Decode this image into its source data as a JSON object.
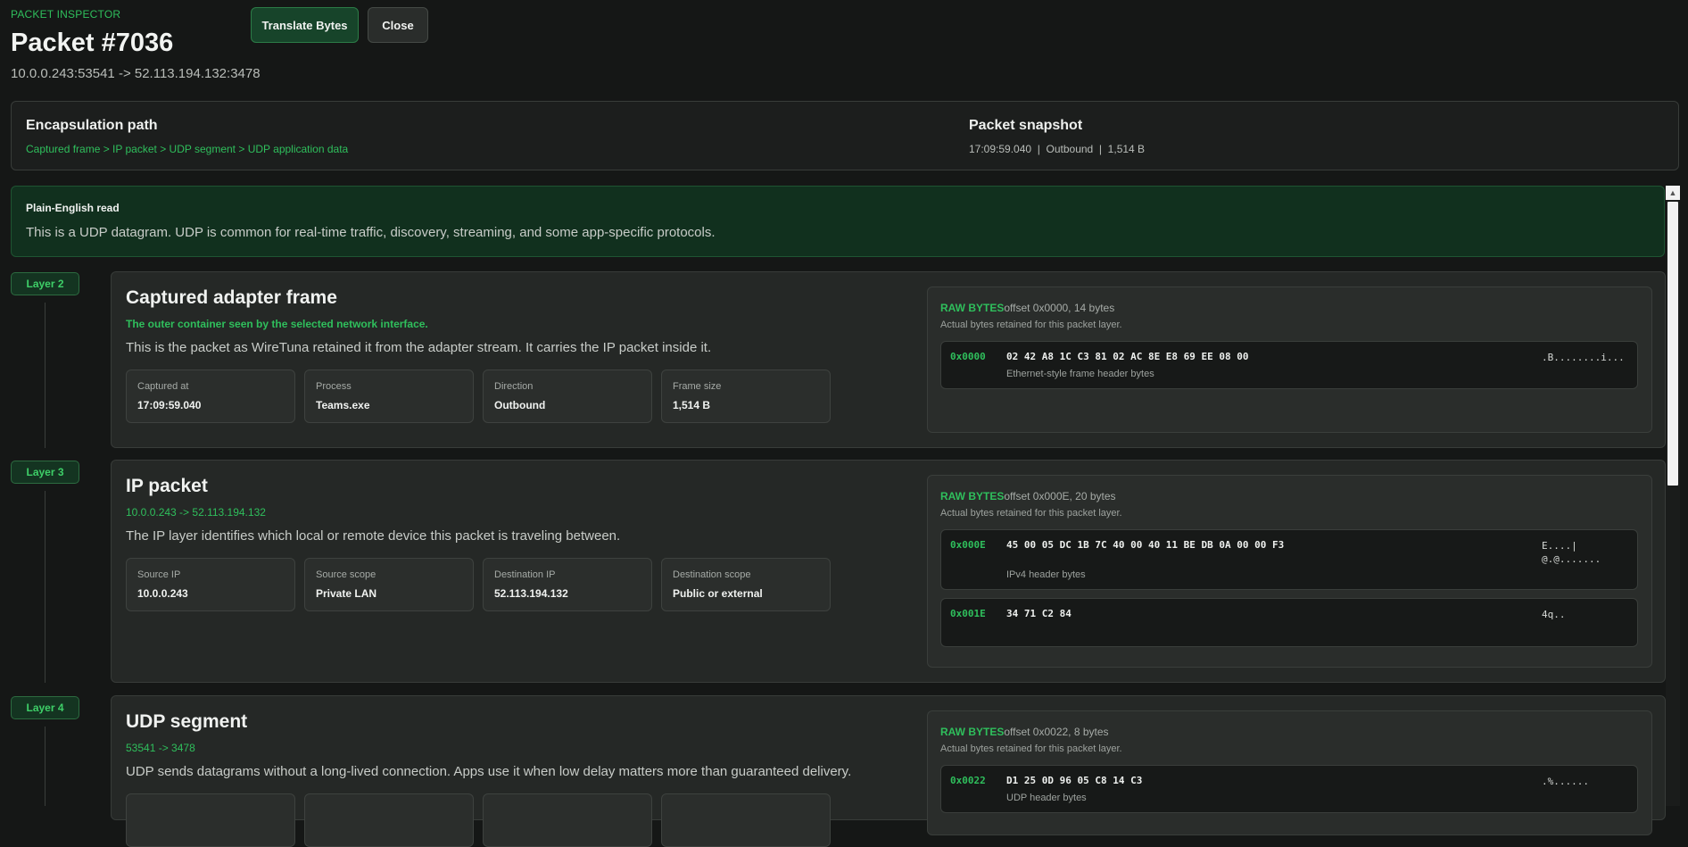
{
  "header": {
    "eyebrow": "PACKET INSPECTOR",
    "title": "Packet #7036",
    "subtitle": "10.0.0.243:53541 -> 52.113.194.132:3478",
    "translate_label": "Translate Bytes",
    "close_label": "Close"
  },
  "summary": {
    "encap_heading": "Encapsulation path",
    "encap_path": "Captured frame > IP packet > UDP segment > UDP application data",
    "snapshot_heading": "Packet snapshot",
    "snapshot_text": "17:09:59.040  |  Outbound  |  1,514 B"
  },
  "plain": {
    "heading": "Plain-English read",
    "text": "This is a UDP datagram. UDP is common for real-time traffic, discovery, streaming, and some app-specific protocols."
  },
  "layers": [
    {
      "pill": "Layer 2",
      "title": "Captured adapter frame",
      "subtitle": "The outer container seen by the selected network interface.",
      "description": "This is the packet as WireTuna retained it from the adapter stream. It carries the IP packet inside it.",
      "fields": [
        {
          "label": "Captured at",
          "value": "17:09:59.040"
        },
        {
          "label": "Process",
          "value": "Teams.exe"
        },
        {
          "label": "Direction",
          "value": "Outbound"
        },
        {
          "label": "Frame size",
          "value": "1,514 B"
        }
      ],
      "raw": {
        "tag": "RAW BYTES",
        "meta": "offset 0x0000, 14 bytes",
        "note": "Actual bytes retained for this packet layer.",
        "rows": [
          {
            "offset": "0x0000",
            "hex": "02 42 A8 1C C3 81 02 AC 8E E8 69 EE 08 00",
            "ascii": ".B........i...",
            "desc": "Ethernet-style frame header bytes"
          }
        ]
      }
    },
    {
      "pill": "Layer 3",
      "title": "IP packet",
      "subtitle": "10.0.0.243 -> 52.113.194.132",
      "description": "The IP layer identifies which local or remote device this packet is traveling between.",
      "fields": [
        {
          "label": "Source IP",
          "value": "10.0.0.243"
        },
        {
          "label": "Source scope",
          "value": "Private LAN"
        },
        {
          "label": "Destination IP",
          "value": "52.113.194.132"
        },
        {
          "label": "Destination scope",
          "value": "Public or external"
        }
      ],
      "raw": {
        "tag": "RAW BYTES",
        "meta": "offset 0x000E, 20 bytes",
        "note": "Actual bytes retained for this packet layer.",
        "rows": [
          {
            "offset": "0x000E",
            "hex": "45 00 05 DC 1B 7C 40 00 40 11 BE DB 0A 00 00 F3",
            "ascii": "E....|\n@.@.......",
            "desc": "IPv4 header bytes"
          },
          {
            "offset": "0x001E",
            "hex": "34 71 C2 84",
            "ascii": "4q..",
            "desc": ""
          }
        ]
      }
    },
    {
      "pill": "Layer 4",
      "title": "UDP segment",
      "subtitle": "53541 -> 3478",
      "description": "UDP sends datagrams without a long-lived connection. Apps use it when low delay matters more than guaranteed delivery.",
      "raw": {
        "tag": "RAW BYTES",
        "meta": "offset 0x0022, 8 bytes",
        "note": "Actual bytes retained for this packet layer.",
        "rows": [
          {
            "offset": "0x0022",
            "hex": "D1 25 0D 96 05 C8 14 C3",
            "ascii": ".%......",
            "desc": "UDP header bytes"
          }
        ]
      }
    }
  ]
}
